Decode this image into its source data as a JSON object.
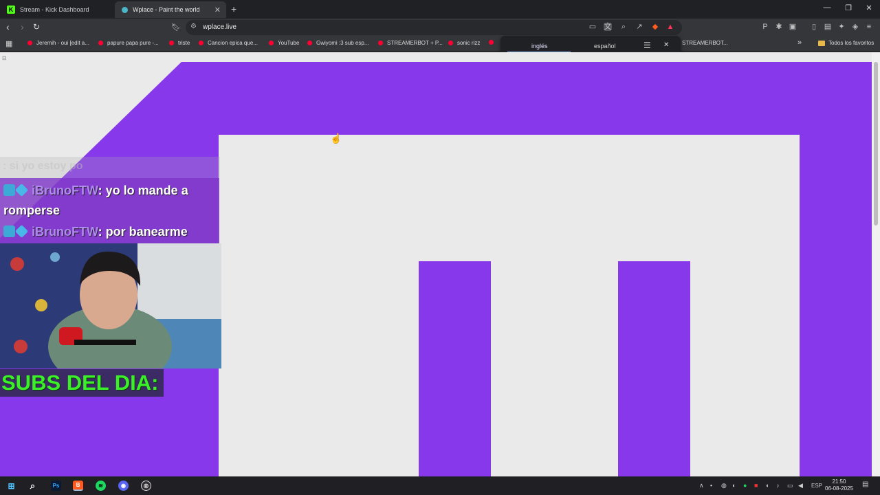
{
  "browser": {
    "tabs": [
      {
        "title": "Stream - Kick Dashboard",
        "active": false
      },
      {
        "title": "Wplace - Paint the world",
        "active": true
      }
    ],
    "url": "wplace.live",
    "bookmarks": [
      "Jeremih - oui [edit a...",
      "papure papa pure -...",
      "triste",
      "Cancion epica que...",
      "YouTube",
      "Gwiyomi :3 sub esp...",
      "STREAMERBOT + P...",
      "sonic rizz",
      "STREAMERBOT..."
    ],
    "bookmarks_folder": "Todos los favoritos",
    "translate": {
      "source": "inglés",
      "target": "español"
    }
  },
  "page": {
    "background": "#eaeaea",
    "accent": "#8738ea"
  },
  "overlay": {
    "chat": [
      {
        "user": "",
        "text": ": si yo estoy po",
        "faded": true
      },
      {
        "user": "iBrunoFTW",
        "text": ": yo lo mande a romperse",
        "faded": false
      },
      {
        "user": "iBrunoFTW",
        "text": ": por banearme",
        "faded": false
      }
    ],
    "subs_label": "SUBS DEL DIA:"
  },
  "taskbar": {
    "apps": [
      "windows-icon",
      "search-icon",
      "photoshop-icon",
      "brave-icon",
      "spotify-icon",
      "discord-icon",
      "obs-icon"
    ],
    "language": "ESP",
    "time": "21:50",
    "date": "06-08-2025"
  }
}
